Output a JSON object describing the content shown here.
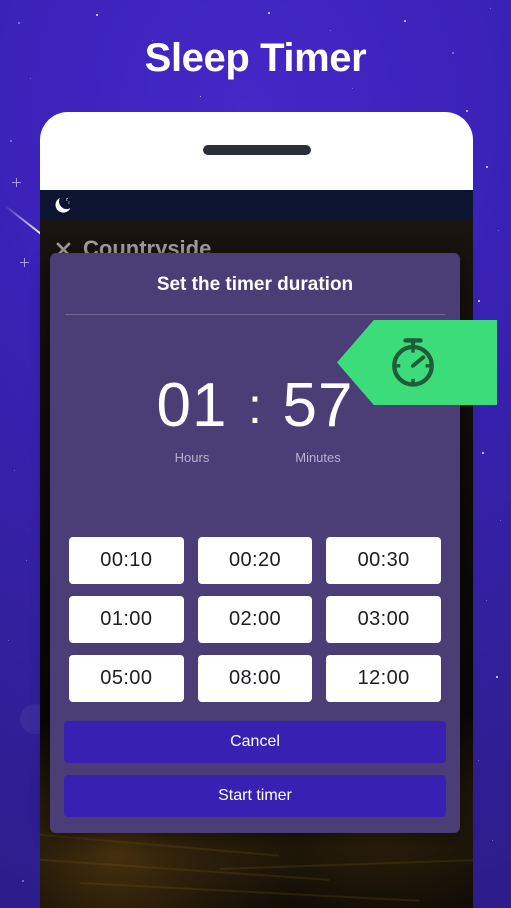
{
  "page": {
    "title": "Sleep Timer",
    "background_color": "#3a21b6"
  },
  "phone": {
    "statusbar": {
      "icon": "moon-sleep-icon"
    },
    "scene": {
      "close_icon": "close-x-icon",
      "title": "Countryside"
    }
  },
  "dialog": {
    "title": "Set the timer duration",
    "ribbon": {
      "icon": "stopwatch-icon",
      "color": "#3ddc7a"
    },
    "time": {
      "hours": "01",
      "separator": ":",
      "minutes": "57",
      "hours_label": "Hours",
      "minutes_label": "Minutes"
    },
    "presets": [
      "00:10",
      "00:20",
      "00:30",
      "01:00",
      "02:00",
      "03:00",
      "05:00",
      "08:00",
      "12:00"
    ],
    "actions": {
      "cancel": "Cancel",
      "start": "Start timer",
      "color": "#3820b3"
    }
  }
}
